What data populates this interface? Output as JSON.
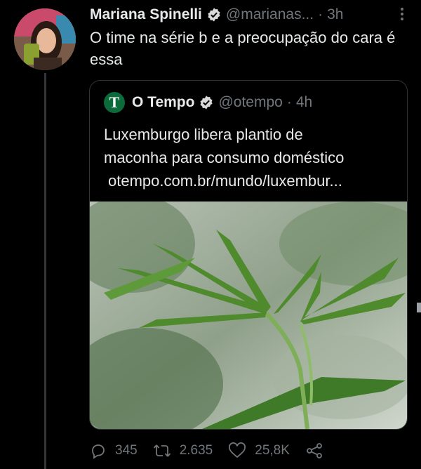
{
  "tweet": {
    "display_name": "Mariana Spinelli",
    "handle": "@marianas...",
    "separator": "·",
    "time": "3h",
    "text": "O time na série b e a preocupação do cara é essa"
  },
  "quoted": {
    "logo_letter": "T",
    "display_name": "O Tempo",
    "handle": "@otempo",
    "separator": "·",
    "time": "4h",
    "text_line1": "Luxemburgo libera plantio de",
    "text_line2": "maconha para consumo doméstico",
    "link": "otempo.com.br/mundo/luxembur..."
  },
  "actions": {
    "replies": "345",
    "retweets": "2.635",
    "likes": "25,8K"
  },
  "colors": {
    "background": "#000000",
    "text": "#e7e9ea",
    "muted": "#71767b",
    "border": "#2f3336",
    "verified_badge": "#d9d9d9",
    "otempo_green": "#0b6b3a"
  },
  "icons": {
    "verified": "verified-icon",
    "more": "more-icon",
    "reply": "reply-icon",
    "retweet": "retweet-icon",
    "like": "heart-icon",
    "share": "share-icon"
  }
}
